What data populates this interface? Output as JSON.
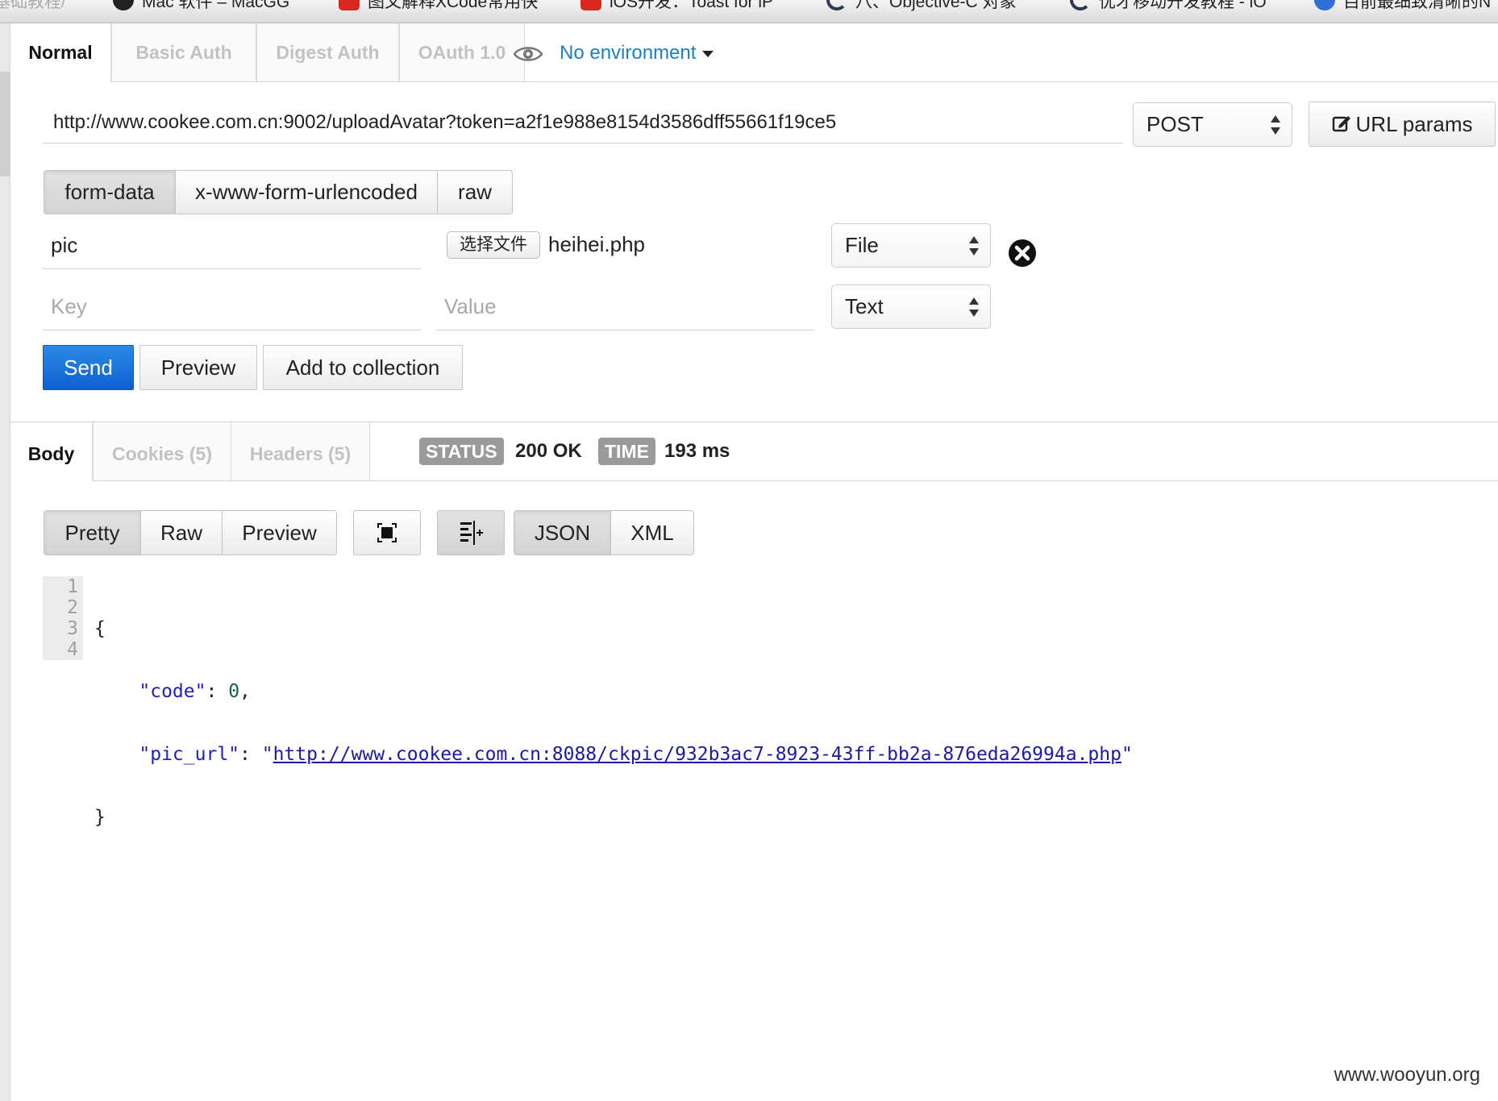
{
  "bookmarks": [
    {
      "label": "基础教程/",
      "favicon": "none"
    },
    {
      "label": "Mac 软件 – MacGG",
      "favicon": "dark"
    },
    {
      "label": "图文解释XCode常用快",
      "favicon": "red"
    },
    {
      "label": "iOS开发：Toast for iP",
      "favicon": "red"
    },
    {
      "label": "八、Objective-C 对象",
      "favicon": "ring"
    },
    {
      "label": "优才移动开发教程 - iO",
      "favicon": "ring"
    },
    {
      "label": "目前最细致清晰的N",
      "favicon": "blue"
    }
  ],
  "auth_tabs": {
    "normal": "Normal",
    "basic": "Basic Auth",
    "digest": "Digest Auth",
    "oauth": "OAuth 1.0"
  },
  "environment": {
    "label": "No environment",
    "icon": "eye-icon"
  },
  "request": {
    "url": "http://www.cookee.com.cn:9002/uploadAvatar?token=a2f1e988e8154d3586dff55661f19ce5",
    "method": "POST",
    "url_params_label": "URL params"
  },
  "body_types": {
    "form_data": "form-data",
    "urlencoded": "x-www-form-urlencoded",
    "raw": "raw",
    "selected": "form-data"
  },
  "form_rows": [
    {
      "key": "pic",
      "file_button": "选择文件",
      "file_name": "heihei.php",
      "type": "File"
    },
    {
      "key_placeholder": "Key",
      "value_placeholder": "Value",
      "type": "Text"
    }
  ],
  "actions": {
    "send": "Send",
    "preview": "Preview",
    "add_to_collection": "Add to collection"
  },
  "response_tabs": {
    "body": "Body",
    "cookies": "Cookies (5)",
    "headers": "Headers (5)"
  },
  "response_meta": {
    "status_label": "STATUS",
    "status_value": "200 OK",
    "time_label": "TIME",
    "time_value": "193 ms"
  },
  "view_modes": {
    "pretty": "Pretty",
    "raw": "Raw",
    "preview": "Preview",
    "json": "JSON",
    "xml": "XML"
  },
  "response_body": {
    "line_numbers": [
      "1",
      "2",
      "3",
      "4"
    ],
    "open_brace": "{",
    "close_brace": "}",
    "code_key": "\"code\"",
    "code_value": "0",
    "pic_url_key": "\"pic_url\"",
    "pic_url_value": "http://www.cookee.com.cn:8088/ckpic/932b3ac7-8923-43ff-bb2a-876eda26994a.php"
  },
  "watermark": "www.wooyun.org",
  "colors": {
    "accent_blue": "#1a7fc4",
    "send_button": "#0d5fcf",
    "pill_gray": "#9a9a9a"
  }
}
